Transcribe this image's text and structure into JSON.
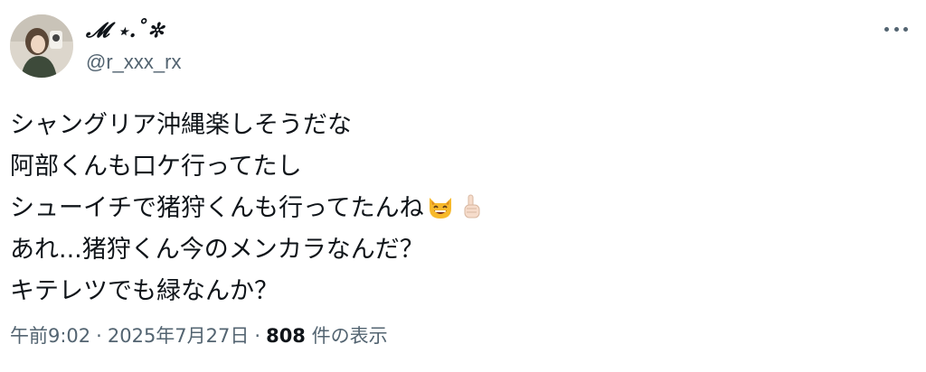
{
  "author": {
    "display_name": "𝓜 ⋆.˚✼",
    "handle": "@r_xxx_rx"
  },
  "tweet": {
    "lines": [
      "シャングリア沖縄楽しそうだな",
      "阿部くんも口ケ行ってたし",
      "シューイチで猪狩くんも行ってたんね",
      "あれ...猪狩くん今のメンカラなんだ？",
      "キテレツでも緑なんか？"
    ],
    "emojis": [
      "grinning-cat-icon",
      "index-pointing-up-icon"
    ]
  },
  "meta": {
    "time": "午前9:02",
    "separator": "·",
    "date": "2025年7月27日",
    "views_count": "808",
    "views_label": "件の表示"
  }
}
